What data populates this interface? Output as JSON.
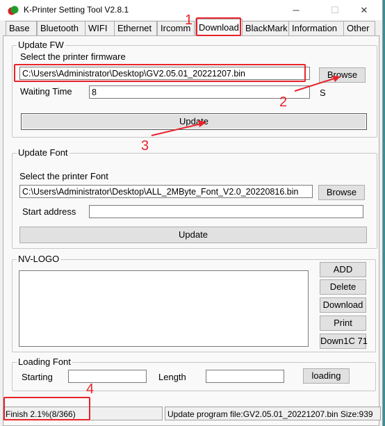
{
  "window": {
    "title": "K-Printer Setting Tool V2.8.1",
    "minimize": "─",
    "maximize": "☐",
    "close": "✕"
  },
  "tabs": [
    "Base",
    "Bluetooth",
    "WIFI",
    "Ethernet",
    "Ircomm",
    "Download",
    "BlackMark",
    "Information",
    "Other"
  ],
  "update_fw": {
    "title": "Update FW",
    "select_label": "Select the printer firmware",
    "path": "C:\\Users\\Administrator\\Desktop\\GV2.05.01_20221207.bin",
    "browse": "Browse",
    "waiting_label": "Waiting Time",
    "waiting_value": "8",
    "unit": "S",
    "update": "Update"
  },
  "update_font": {
    "title": "Update Font",
    "select_label": "Select the printer Font",
    "path": "C:\\Users\\Administrator\\Desktop\\ALL_2MByte_Font_V2.0_20220816.bin",
    "browse": "Browse",
    "start_label": "Start address",
    "start_value": "",
    "update": "Update"
  },
  "nv_logo": {
    "title": "NV-LOGO",
    "buttons": [
      "ADD",
      "Delete",
      "Download",
      "Print",
      "Down1C 71"
    ]
  },
  "loading_font": {
    "title": "Loading Font",
    "starting_label": "Starting",
    "starting_value": "",
    "length_label": "Length",
    "length_value": "",
    "loading": "loading"
  },
  "status": {
    "left": "Finish 2.1%(8/366)",
    "right": "Update program file:GV2.05.01_20221207.bin Size:939"
  },
  "annotations": {
    "color": "#e8232a",
    "numbers": [
      "1",
      "2",
      "3",
      "4"
    ]
  }
}
